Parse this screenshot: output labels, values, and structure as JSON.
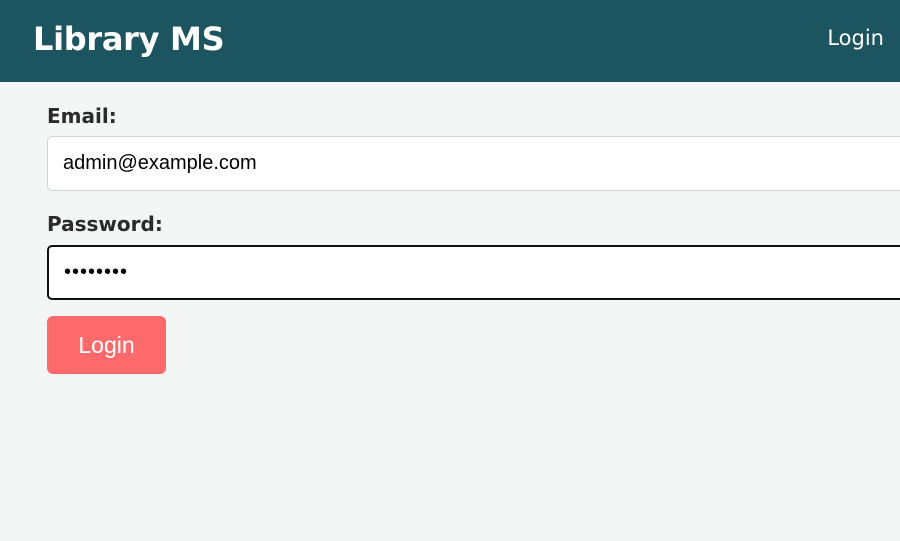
{
  "header": {
    "brand": "Library MS",
    "nav_login": "Login"
  },
  "form": {
    "email": {
      "label": "Email:",
      "value": "admin@example.com"
    },
    "password": {
      "label": "Password:",
      "value": "••••••••"
    },
    "submit_label": "Login"
  },
  "colors": {
    "header_background": "#1c555f",
    "page_background": "#f4f5f5",
    "button_background": "#fe6a6b"
  }
}
